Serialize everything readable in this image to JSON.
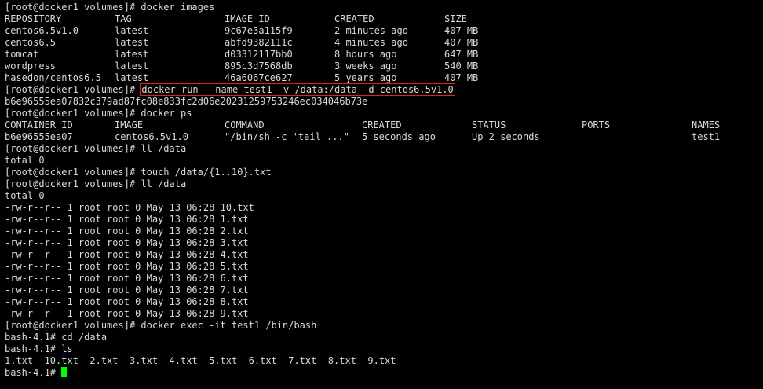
{
  "prompt": "[root@docker1 volumes]# ",
  "bash_prompt": "bash-4.1# ",
  "cmd_images": "docker images",
  "images_headers": [
    "REPOSITORY",
    "TAG",
    "IMAGE ID",
    "CREATED",
    "SIZE"
  ],
  "images": [
    [
      "centos6.5v1.0",
      "latest",
      "9c67e3a115f9",
      "2 minutes ago",
      "407 MB"
    ],
    [
      "centos6.5",
      "latest",
      "abfd9382111c",
      "4 minutes ago",
      "407 MB"
    ],
    [
      "tomcat",
      "latest",
      "d03312117bb0",
      "8 hours ago",
      "647 MB"
    ],
    [
      "wordpress",
      "latest",
      "895c3d7568db",
      "3 weeks ago",
      "540 MB"
    ],
    [
      "hasedon/centos6.5",
      "latest",
      "46a6067ce627",
      "5 years ago",
      "407 MB"
    ]
  ],
  "cmd_run": "docker run --name test1 -v /data:/data -d centos6.5v1.0",
  "container_hash": "b6e96555ea07832c379ad87fc08e833fc2d06e20231259753246ec034046b73e",
  "cmd_ps": "docker ps",
  "ps_headers": [
    "CONTAINER ID",
    "IMAGE",
    "COMMAND",
    "CREATED",
    "STATUS",
    "PORTS",
    "NAMES"
  ],
  "ps_row": [
    "b6e96555ea07",
    "centos6.5v1.0",
    "\"/bin/sh -c 'tail ...\"",
    "5 seconds ago",
    "Up 2 seconds",
    "",
    "test1"
  ],
  "cmd_ll": "ll /data",
  "total0": "total 0",
  "cmd_touch": "touch /data/{1..10}.txt",
  "files": [
    "-rw-r--r-- 1 root root 0 May 13 06:28 10.txt",
    "-rw-r--r-- 1 root root 0 May 13 06:28 1.txt",
    "-rw-r--r-- 1 root root 0 May 13 06:28 2.txt",
    "-rw-r--r-- 1 root root 0 May 13 06:28 3.txt",
    "-rw-r--r-- 1 root root 0 May 13 06:28 4.txt",
    "-rw-r--r-- 1 root root 0 May 13 06:28 5.txt",
    "-rw-r--r-- 1 root root 0 May 13 06:28 6.txt",
    "-rw-r--r-- 1 root root 0 May 13 06:28 7.txt",
    "-rw-r--r-- 1 root root 0 May 13 06:28 8.txt",
    "-rw-r--r-- 1 root root 0 May 13 06:28 9.txt"
  ],
  "cmd_exec": "docker exec -it test1 /bin/bash",
  "cmd_cd": "cd /data",
  "cmd_ls": "ls",
  "ls_output": "1.txt  10.txt  2.txt  3.txt  4.txt  5.txt  6.txt  7.txt  8.txt  9.txt",
  "colors": {
    "background": "#000000",
    "text": "#d9d9d9",
    "highlight_border": "#e0201a",
    "cursor": "#00ff00"
  }
}
